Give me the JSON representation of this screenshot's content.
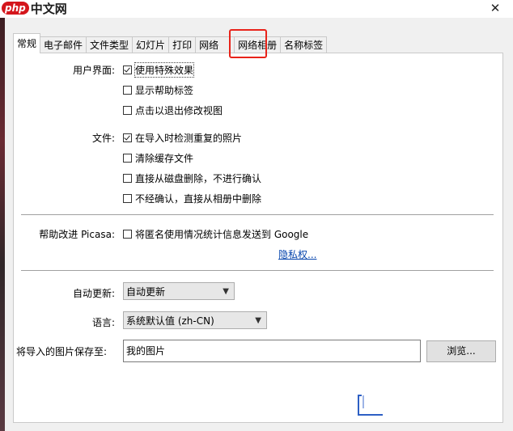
{
  "app": {
    "logo_badge": "php",
    "logo_text": "中文网",
    "close": "✕"
  },
  "tabs": [
    {
      "label": "常规"
    },
    {
      "label": "电子邮件"
    },
    {
      "label": "文件类型"
    },
    {
      "label": "幻灯片"
    },
    {
      "label": "打印"
    },
    {
      "label": "网络"
    },
    {
      "label": "网络相册"
    },
    {
      "label": "名称标签"
    }
  ],
  "ui_section": {
    "label": "用户界面:",
    "options": [
      {
        "label": "使用特殊效果",
        "checked": true
      },
      {
        "label": "显示帮助标签",
        "checked": false
      },
      {
        "label": "点击以退出修改视图",
        "checked": false
      }
    ]
  },
  "file_section": {
    "label": "文件:",
    "options": [
      {
        "label": "在导入时检测重复的照片",
        "checked": true
      },
      {
        "label": "清除缓存文件",
        "checked": false
      },
      {
        "label": "直接从磁盘删除，不进行确认",
        "checked": false
      },
      {
        "label": "不经确认，直接从相册中删除",
        "checked": false
      }
    ]
  },
  "help_section": {
    "label": "帮助改进 Picasa:",
    "option": {
      "label": "将匿名使用情况统计信息发送到 Google",
      "checked": false
    },
    "privacy_link": "隐私权..."
  },
  "auto_update": {
    "label": "自动更新:",
    "value": "自动更新"
  },
  "language": {
    "label": "语言:",
    "value": "系统默认值 (zh-CN)"
  },
  "save_location": {
    "label": "将导入的图片保存至:",
    "value": "我的图片",
    "browse": "浏览..."
  },
  "colors": {
    "highlight": "#e8231a",
    "link": "#0645ad",
    "logo_red": "#d4161c"
  }
}
